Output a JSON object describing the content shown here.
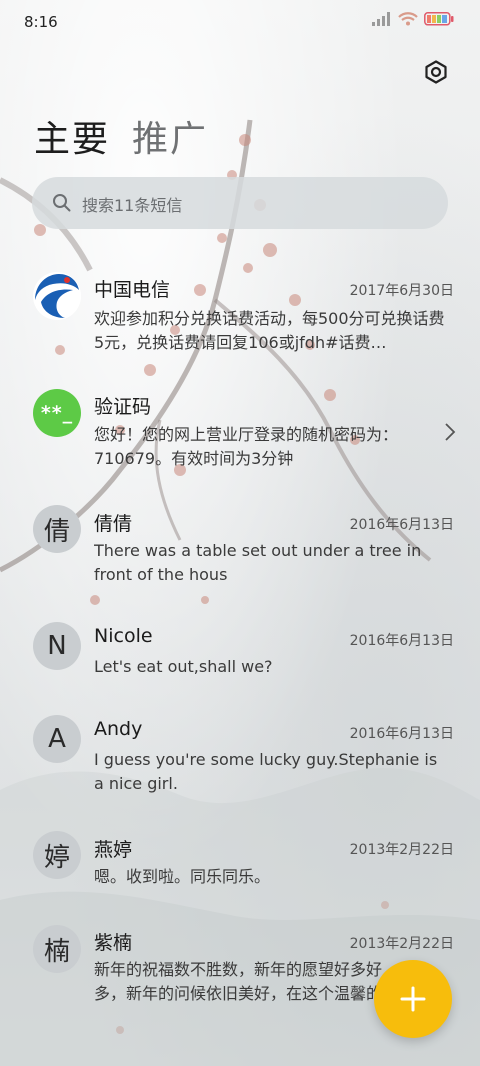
{
  "status_bar": {
    "time": "8:16"
  },
  "tabs": [
    {
      "label": "主要"
    },
    {
      "label": "推广"
    }
  ],
  "search": {
    "placeholder": "搜索11条短信"
  },
  "conversations": [
    {
      "name": "中国电信",
      "date": "2017年6月30日",
      "preview": "欢迎参加积分兑换话费活动，每500分可兑换话费5元，兑换话费请回复106或jfdh#话费…",
      "avatar": "telecom-logo"
    },
    {
      "name": "验证码",
      "date": "",
      "preview": "您好！您的网上营业厅登录的随机密码为：710679。有效时间为3分钟",
      "avatar_text": "**_"
    },
    {
      "name": "倩倩",
      "date": "2016年6月13日",
      "preview": "There was a table set out under a tree in front of the hous",
      "avatar_text": "倩"
    },
    {
      "name": "Nicole",
      "date": "2016年6月13日",
      "preview": "Let's eat out,shall we?",
      "avatar_text": "N"
    },
    {
      "name": "Andy",
      "date": "2016年6月13日",
      "preview": "I guess you're some lucky guy.Stephanie is a nice girl.",
      "avatar_text": "A"
    },
    {
      "name": "燕婷",
      "date": "2013年2月22日",
      "preview": "嗯。收到啦。同乐同乐。",
      "avatar_text": "婷"
    },
    {
      "name": "紫楠",
      "date": "2013年2月22日",
      "preview": "新年的祝福数不胜数，新年的愿望好多好多，新年的问候依旧美好，在这个温馨的",
      "avatar_text": "楠"
    }
  ],
  "colors": {
    "accent": "#f7bd0c",
    "verification_avatar": "#5dca46",
    "telecom_blue": "#1a5fb4"
  },
  "icons": {
    "settings": "settings-icon",
    "search": "search-icon",
    "compose": "plus-icon",
    "chevron": "chevron-right-icon"
  }
}
